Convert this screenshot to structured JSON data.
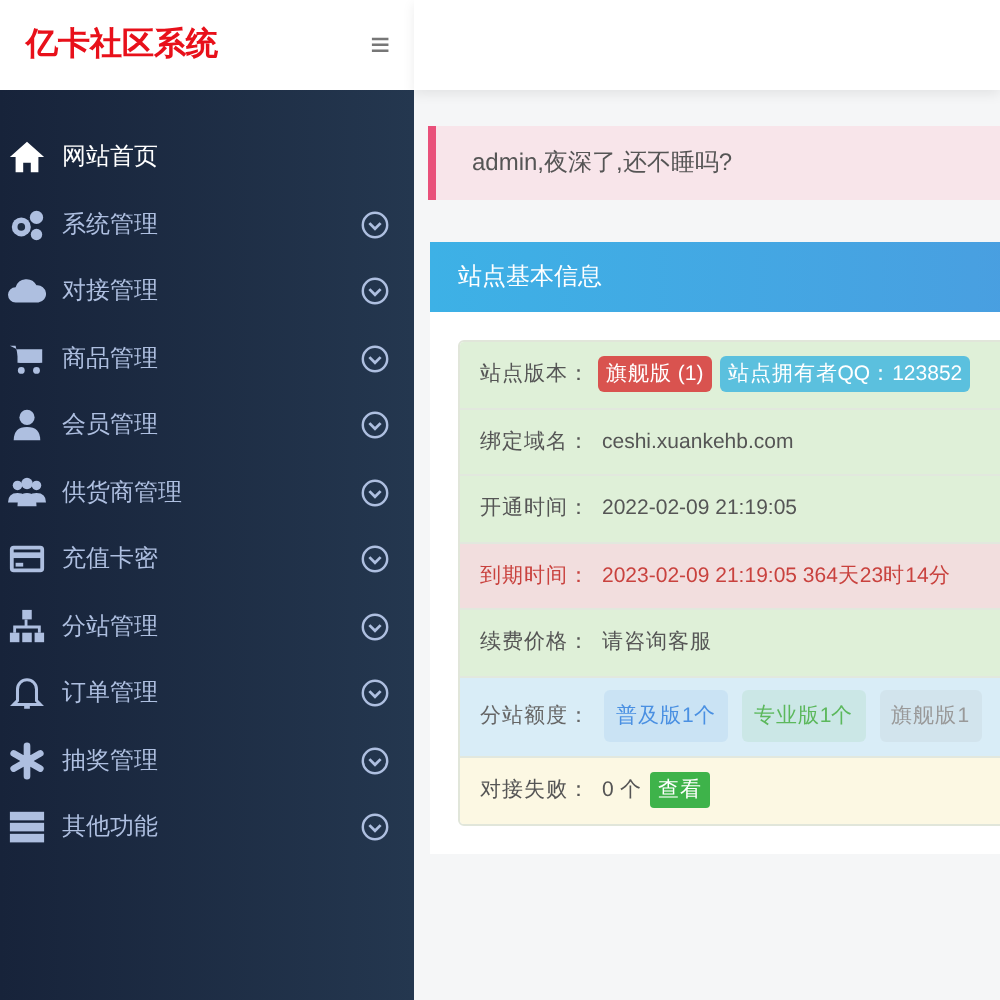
{
  "header": {
    "logo": "亿卡社区系统",
    "menu_icon": "≡"
  },
  "sidebar": {
    "items": [
      {
        "label": "网站首页",
        "expandable": false
      },
      {
        "label": "系统管理",
        "expandable": true
      },
      {
        "label": "对接管理",
        "expandable": true
      },
      {
        "label": "商品管理",
        "expandable": true
      },
      {
        "label": "会员管理",
        "expandable": true
      },
      {
        "label": "供货商管理",
        "expandable": true
      },
      {
        "label": "充值卡密",
        "expandable": true
      },
      {
        "label": "分站管理",
        "expandable": true
      },
      {
        "label": "订单管理",
        "expandable": true
      },
      {
        "label": "抽奖管理",
        "expandable": true
      },
      {
        "label": "其他功能",
        "expandable": true
      }
    ]
  },
  "alert": {
    "text": "admin,夜深了,还不睡吗?"
  },
  "card": {
    "title": "站点基本信息",
    "rows": [
      {
        "kind": "success",
        "label": "站点版本：",
        "badges": [
          {
            "text": "旗舰版 (1)",
            "color": "#d9534f"
          },
          {
            "text": "站点拥有者QQ：123852",
            "color": "#5bc0de"
          }
        ]
      },
      {
        "kind": "success",
        "label": "绑定域名：",
        "value": "ceshi.xuankehb.com"
      },
      {
        "kind": "success",
        "label": "开通时间：",
        "value": "2022-02-09 21:19:05"
      },
      {
        "kind": "danger",
        "label": "到期时间：",
        "value": "2023-02-09 21:19:05 364天23时14分"
      },
      {
        "kind": "success",
        "label": "续费价格：",
        "value": "请咨询客服"
      },
      {
        "kind": "info",
        "label": "分站额度：",
        "chips": [
          {
            "text": "普及版1个",
            "color": "#4a90e2"
          },
          {
            "text": "专业版1个",
            "color": "#5cb85c"
          },
          {
            "text": "旗舰版1",
            "color": "#999999"
          }
        ]
      },
      {
        "kind": "warning",
        "label": "对接失败：",
        "value": "0 个",
        "button": "查看"
      }
    ]
  }
}
